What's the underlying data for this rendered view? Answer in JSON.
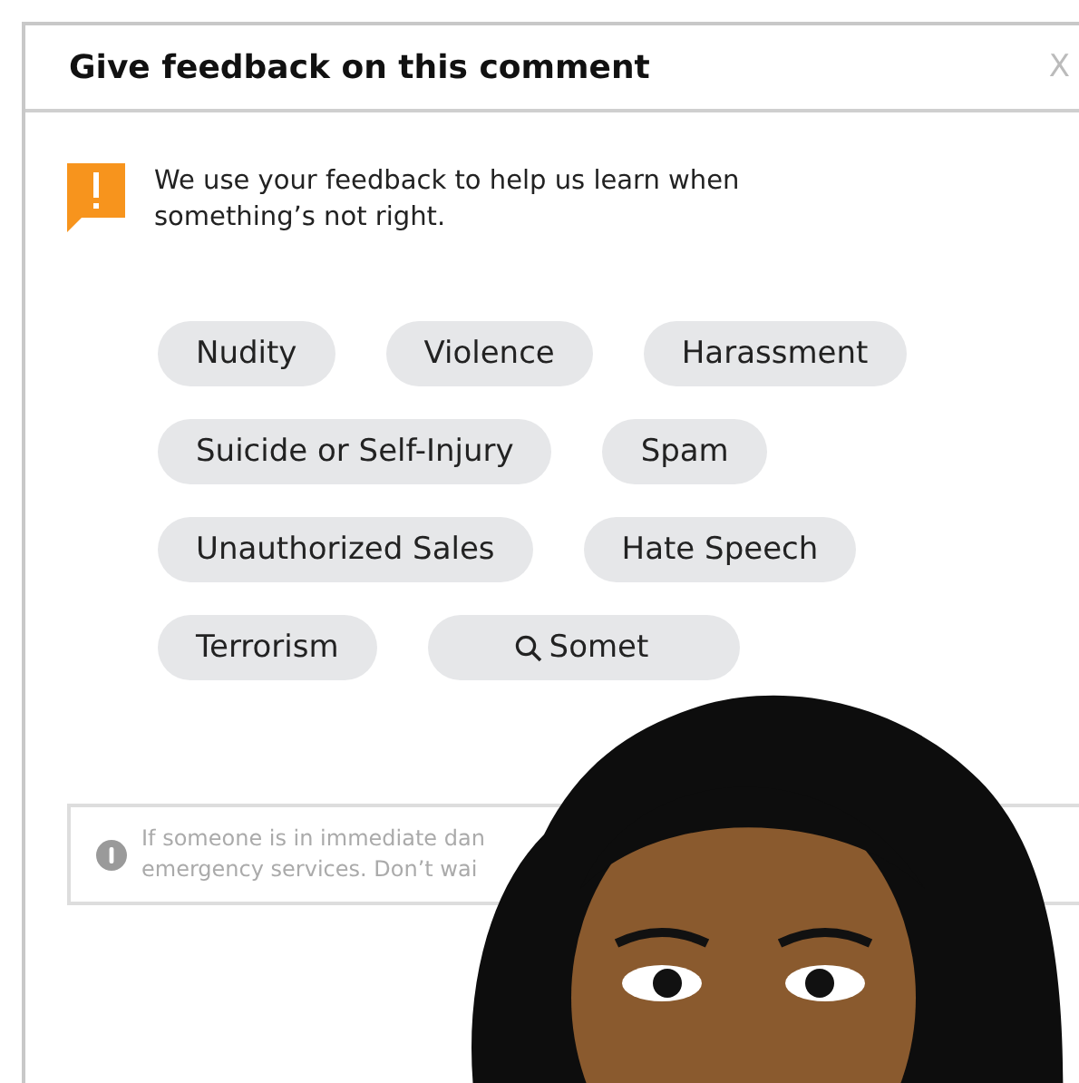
{
  "dialog": {
    "title": "Give feedback on this comment",
    "close": "X"
  },
  "intro": "We use your feedback to help us learn when something’s not right.",
  "option_rows": [
    [
      {
        "label": "Nudity",
        "kind": "plain"
      },
      {
        "label": "Violence",
        "kind": "plain"
      },
      {
        "label": "Harassment",
        "kind": "plain"
      }
    ],
    [
      {
        "label": "Suicide or Self-Injury",
        "kind": "plain"
      },
      {
        "label": "Spam",
        "kind": "plain"
      }
    ],
    [
      {
        "label": "Unauthorized Sales",
        "kind": "plain"
      },
      {
        "label": "Hate Speech",
        "kind": "plain"
      }
    ],
    [
      {
        "label": "Terrorism",
        "kind": "plain"
      },
      {
        "label": "Somet",
        "kind": "search"
      }
    ]
  ],
  "notice": {
    "lines": [
      "If someone is in immediate dan",
      "emergency services. Don’t wai"
    ]
  }
}
